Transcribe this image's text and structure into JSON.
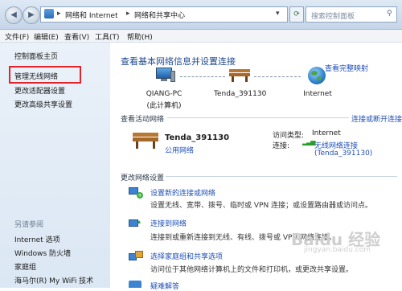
{
  "address_bar": {
    "crumbs": [
      "网络和 Internet",
      "网络和共享中心"
    ],
    "search_placeholder": "搜索控制面板"
  },
  "menu": [
    "文件(F)",
    "编辑(E)",
    "查看(V)",
    "工具(T)",
    "帮助(H)"
  ],
  "sidebar": {
    "home": "控制面板主页",
    "items": [
      "管理无线网络",
      "更改适配器设置",
      "更改高级共享设置"
    ],
    "see_also_heading": "另请参阅",
    "see_also": [
      "Internet 选项",
      "Windows 防火墙",
      "家庭组",
      "海马尔(R) My WiFi 技术"
    ]
  },
  "main": {
    "title": "查看基本网络信息并设置连接",
    "full_map_link": "查看完整映射",
    "nodes": [
      {
        "name": "QIANG-PC",
        "sub": "(此计算机)"
      },
      {
        "name": "Tenda_391130",
        "sub": ""
      },
      {
        "name": "Internet",
        "sub": ""
      }
    ],
    "active_heading": "查看活动网络",
    "connect_link": "连接或断开连接",
    "network": {
      "name": "Tenda_391130",
      "type": "公用网络",
      "access_label": "访问类型:",
      "access_value": "Internet",
      "conn_label": "连接:",
      "conn_value": "无线网络连接",
      "conn_sub": "(Tenda_391130)"
    },
    "change_heading": "更改网络设置",
    "tasks": [
      {
        "title": "设置新的连接或网络",
        "desc": "设置无线、宽带、拨号、临时或 VPN 连接；或设置路由器或访问点。"
      },
      {
        "title": "连接到网络",
        "desc": "连接到或重新连接到无线、有线、拨号或 VPN 网络连接。"
      },
      {
        "title": "选择家庭组和共享选项",
        "desc": "访问位于其他网络计算机上的文件和打印机，或更改共享设置。"
      },
      {
        "title": "疑难解答",
        "desc": ""
      }
    ]
  },
  "watermark": "Baidu 经验",
  "watermark_url": "jingyan.baidu.com"
}
